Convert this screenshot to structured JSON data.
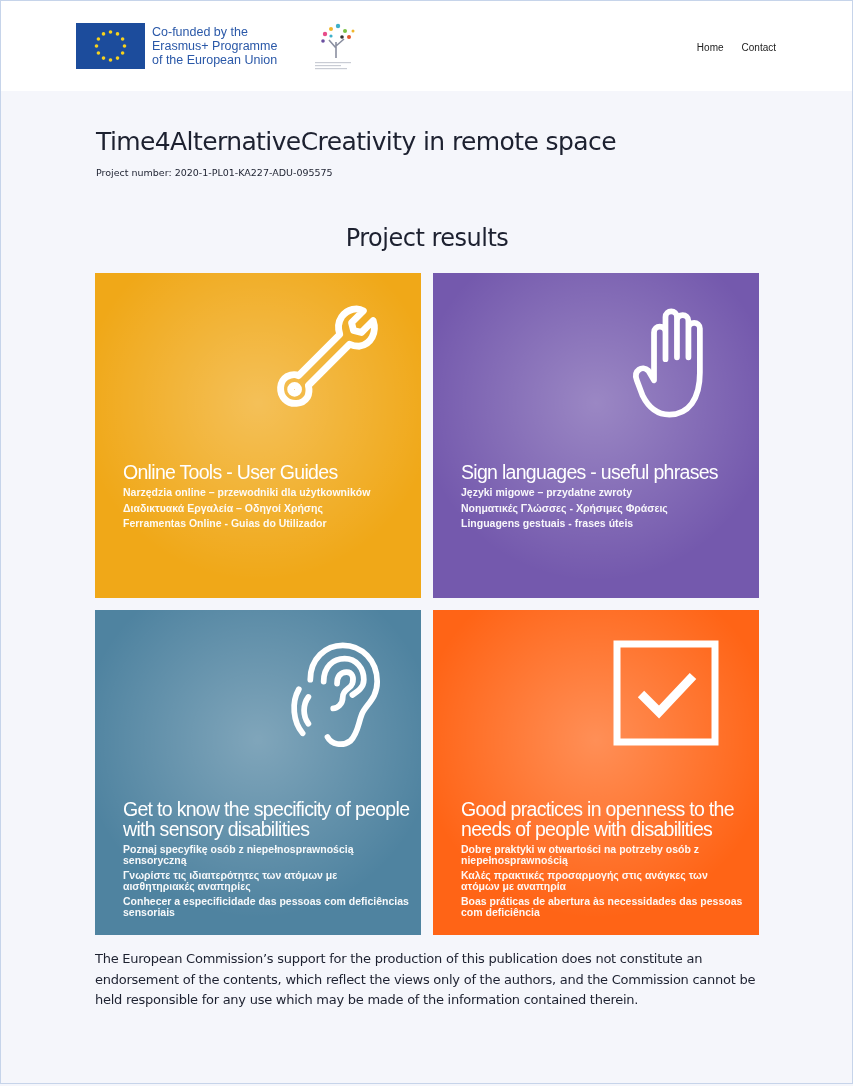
{
  "header": {
    "eu_text": [
      "Co-funded by the",
      "Erasmus+ Programme",
      "of the European Union"
    ],
    "nav": [
      {
        "label": "Home"
      },
      {
        "label": "Contact"
      }
    ]
  },
  "title": "Time4AlternativeCreativity in remote space",
  "project_number": "Project number: 2020-1-PL01-KA227-ADU-095575",
  "section_title": "Project results",
  "cards": [
    {
      "kind": "wrench",
      "color": "#f0a818",
      "title": "Online Tools - User Guides",
      "lines": [
        "Narzędzia online – przewodniki dla użytkowników",
        "Διαδικτυακά Εργαλεία – Οδηγοί Χρήσης",
        "Ferramentas Online - Guias do Utilizador"
      ]
    },
    {
      "kind": "hand",
      "color": "#7459ad",
      "title": "Sign languages - useful phrases",
      "lines": [
        "Języki migowe – przydatne zwroty",
        "Νοηματικές Γλώσσες - Χρήσιμες Φράσεις",
        "Linguagens gestuais - frases úteis"
      ]
    },
    {
      "kind": "ear",
      "color": "#4f83a0",
      "title": "Get to know the specificity of people with sensory disabilities",
      "lines": [
        "Poznaj specyfikę osób z niepełnosprawnością sensoryczną",
        "Γνωρίστε τις ιδιαιτερότητες των ατόμων με αισθητηριακές αναπηρίες",
        "Conhecer a especificidade das pessoas com deficiências sensoriais"
      ]
    },
    {
      "kind": "check",
      "color": "#ff6416",
      "title": "Good practices in openness to the needs of people with disabilities",
      "lines": [
        "Dobre praktyki w otwartości na potrzeby osób z niepełnosprawnością",
        "Καλές πρακτικές προσαρμογής στις ανάγκες των ατόμων με αναπηρία",
        "Boas práticas de abertura às necessidades das pessoas com deficiência"
      ]
    }
  ],
  "disclaimer": "The European Commission’s support for the production of this publication does not constitute an endorsement of the contents, which reflect the views only of the authors, and the Commission cannot be held responsible for any use which may be made of the information contained therein."
}
